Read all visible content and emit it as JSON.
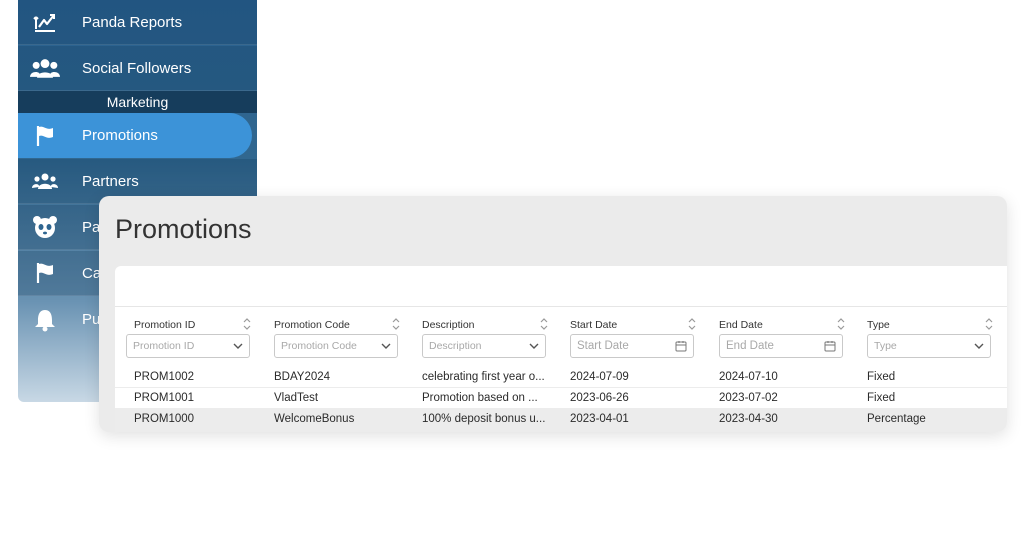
{
  "sidebar": {
    "items_top": [
      {
        "label": "Panda Reports",
        "icon": "chart-trend-icon"
      },
      {
        "label": "Social Followers",
        "icon": "users-group-icon"
      }
    ],
    "section_header": "Marketing",
    "items_marketing": [
      {
        "label": "Promotions",
        "icon": "flag-icon",
        "active": true
      },
      {
        "label": "Partners",
        "icon": "handshake-icon"
      },
      {
        "label": "Pa",
        "icon": "panda-icon"
      },
      {
        "label": "Ca",
        "icon": "flag-icon"
      },
      {
        "label": "Pu",
        "icon": "bell-icon"
      }
    ]
  },
  "panel": {
    "title": "Promotions",
    "columns": [
      {
        "key": "id",
        "header": "Promotion ID",
        "placeholder": "Promotion ID",
        "filter": "select"
      },
      {
        "key": "code",
        "header": "Promotion Code",
        "placeholder": "Promotion Code",
        "filter": "select"
      },
      {
        "key": "description",
        "header": "Description",
        "placeholder": "Description",
        "filter": "select"
      },
      {
        "key": "start",
        "header": "Start Date",
        "placeholder": "Start Date",
        "filter": "date"
      },
      {
        "key": "end",
        "header": "End Date",
        "placeholder": "End Date",
        "filter": "date"
      },
      {
        "key": "type",
        "header": "Type",
        "placeholder": "Type",
        "filter": "select"
      }
    ],
    "rows": [
      {
        "id": "PROM1002",
        "code": "BDAY2024",
        "description": "celebrating first year o...",
        "start": "2024-07-09",
        "end": "2024-07-10",
        "type": "Fixed"
      },
      {
        "id": "PROM1001",
        "code": "VladTest",
        "description": "Promotion based on ...",
        "start": "2023-06-26",
        "end": "2023-07-02",
        "type": "Fixed"
      },
      {
        "id": "PROM1000",
        "code": "WelcomeBonus",
        "description": "100% deposit bonus u...",
        "start": "2023-04-01",
        "end": "2023-04-30",
        "type": "Percentage"
      }
    ]
  },
  "colors": {
    "sidebar_top": "#2a6190",
    "sidebar_active": "#3c93d8",
    "section_header_bg": "#163d5c",
    "panel_bg": "#ebebeb",
    "row_highlight": "#ececec"
  }
}
